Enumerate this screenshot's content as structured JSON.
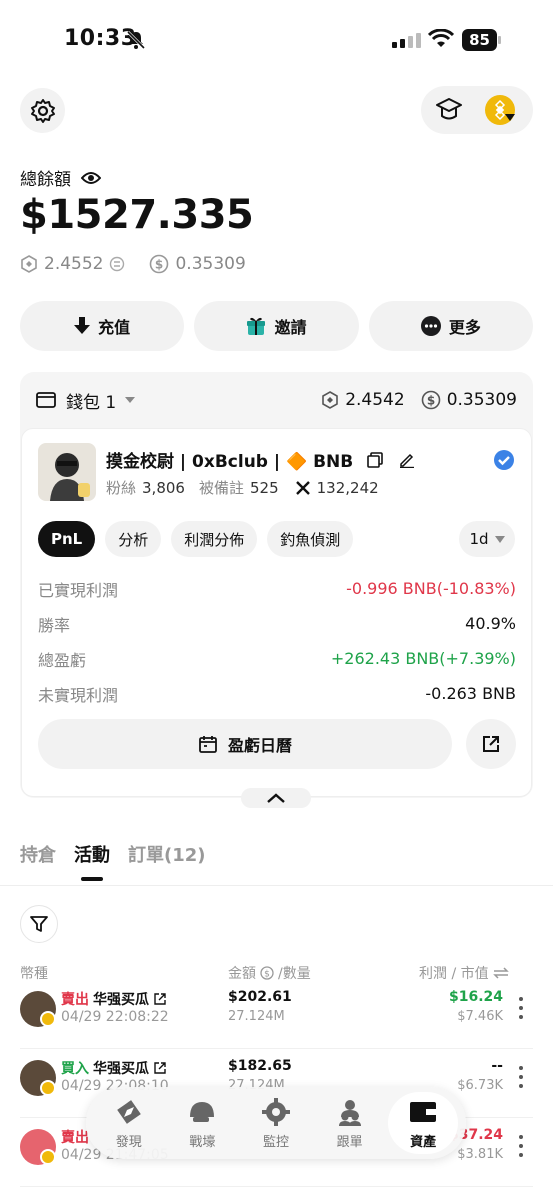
{
  "status": {
    "time": "10:33",
    "battery": "85"
  },
  "balance": {
    "label": "總餘額",
    "value": "$1527.335",
    "bnb": "2.4552",
    "usd_coin": "0.35309"
  },
  "actions": [
    {
      "label": "充值"
    },
    {
      "label": "邀請"
    },
    {
      "label": "更多"
    }
  ],
  "wallet": {
    "name": "錢包 1",
    "bnb": "2.4542",
    "usd_coin": "0.35309",
    "profile": {
      "name": "摸金校尉 | 0xBclub | 🔶 BNB",
      "followers_label": "粉絲",
      "followers": "3,806",
      "noted_label": "被備註",
      "noted": "525",
      "x_count": "132,242"
    },
    "chips": [
      {
        "label": "PnL"
      },
      {
        "label": "分析"
      },
      {
        "label": "利潤分佈"
      },
      {
        "label": "釣魚偵測"
      }
    ],
    "period": "1d",
    "stats": [
      {
        "key": "已實現利潤",
        "value": "-0.996 BNB(-10.83%)",
        "tone": "red"
      },
      {
        "key": "勝率",
        "value": "40.9%",
        "tone": "plain"
      },
      {
        "key": "總盈虧",
        "value": "+262.43 BNB(+7.39%)",
        "tone": "green"
      },
      {
        "key": "未實現利潤",
        "value": "-0.263 BNB",
        "tone": "plain"
      }
    ],
    "calendar_label": "盈虧日曆"
  },
  "tabs": [
    {
      "label": "持倉"
    },
    {
      "label": "活動"
    },
    {
      "label": "訂單(12)"
    }
  ],
  "columns": {
    "token": "幣種",
    "amount": "金額",
    "qty": "/數量",
    "pnl": "利潤 / 市值"
  },
  "transactions": [
    {
      "side": "賣出",
      "side_color": "#e0374a",
      "token": "华强买瓜",
      "time": "04/29 22:08:22",
      "amount": "$202.61",
      "qty": "27.124M",
      "pnl": "$16.24",
      "pnl_color": "#1fa34a",
      "mv": "$7.46K"
    },
    {
      "side": "買入",
      "side_color": "#1fa34a",
      "token": "华强买瓜",
      "time": "04/29 22:08:10",
      "amount": "$182.65",
      "qty": "27.124M",
      "pnl": "--",
      "pnl_color": "#111111",
      "mv": "$6.73K"
    },
    {
      "side": "賣出",
      "side_color": "#e0374a",
      "token": "",
      "time": "04/29 21:47:05",
      "amount": "",
      "qty": "",
      "pnl": "$37.24",
      "pnl_color": "#e0374a",
      "mv": "$3.81K"
    }
  ],
  "nav": [
    {
      "label": "發現",
      "icon": "compass-icon"
    },
    {
      "label": "戰壕",
      "icon": "helmet-icon"
    },
    {
      "label": "監控",
      "icon": "monitor-icon"
    },
    {
      "label": "跟單",
      "icon": "users-icon"
    },
    {
      "label": "資產",
      "icon": "wallet-icon"
    }
  ]
}
